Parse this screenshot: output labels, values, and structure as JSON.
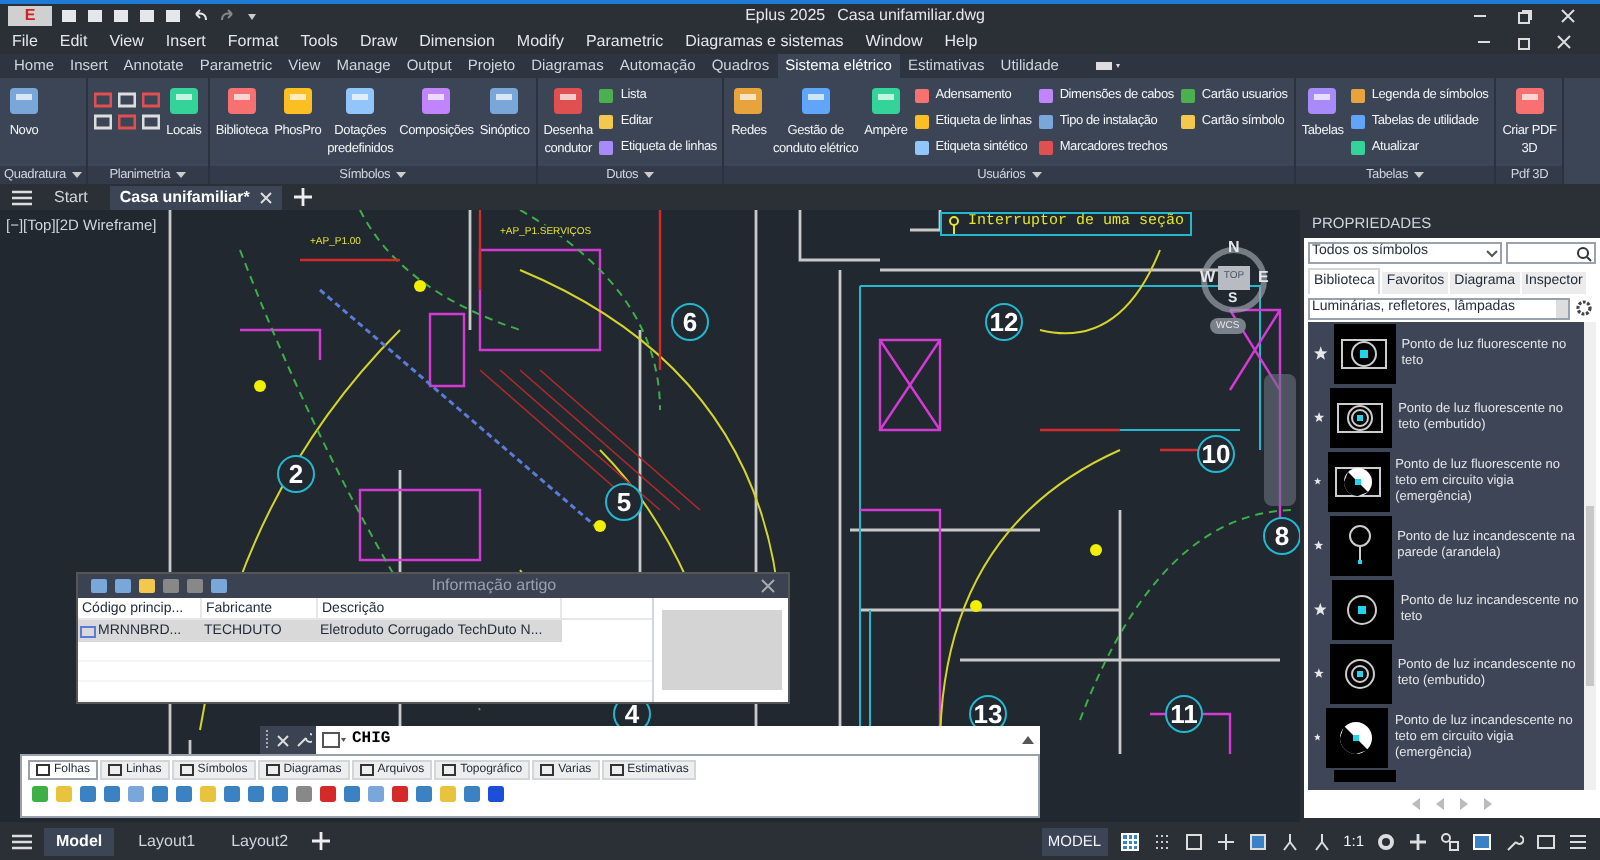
{
  "window": {
    "logo": "E",
    "title": "Eplus 2025",
    "document": "Casa unifamiliar.dwg"
  },
  "menu": [
    "File",
    "Edit",
    "View",
    "Insert",
    "Format",
    "Tools",
    "Draw",
    "Dimension",
    "Modify",
    "Parametric",
    "Diagramas e sistemas",
    "Window",
    "Help"
  ],
  "ribbon_tabs": [
    {
      "label": "Home",
      "selected": false
    },
    {
      "label": "Insert",
      "selected": false
    },
    {
      "label": "Annotate",
      "selected": false
    },
    {
      "label": "Parametric",
      "selected": false
    },
    {
      "label": "View",
      "selected": false
    },
    {
      "label": "Manage",
      "selected": false
    },
    {
      "label": "Output",
      "selected": false
    },
    {
      "label": "Projeto",
      "selected": false
    },
    {
      "label": "Diagramas",
      "selected": false
    },
    {
      "label": "Automação",
      "selected": false
    },
    {
      "label": "Quadros",
      "selected": false
    },
    {
      "label": "Sistema elétrico",
      "selected": true
    },
    {
      "label": "Estimativas",
      "selected": false
    },
    {
      "label": "Utilidade",
      "selected": false
    }
  ],
  "ribbon_panels": [
    {
      "label": "Quadratura",
      "items": [
        {
          "kind": "large",
          "label": "Novo"
        }
      ]
    },
    {
      "label": "Planimetria",
      "items": [
        {
          "kind": "icon"
        },
        {
          "kind": "icon"
        },
        {
          "kind": "icon"
        },
        {
          "kind": "icon"
        },
        {
          "kind": "icon"
        },
        {
          "kind": "icon"
        },
        {
          "kind": "large",
          "label": "Locais"
        }
      ]
    },
    {
      "label": "Símbolos",
      "items": [
        {
          "kind": "large",
          "label": "Biblioteca"
        },
        {
          "kind": "large",
          "label": "PhosPro"
        },
        {
          "kind": "large",
          "label": "Dotações\npredefinidos"
        },
        {
          "kind": "large",
          "label": "Composições"
        },
        {
          "kind": "large",
          "label": "Sinóptico"
        }
      ]
    },
    {
      "label": "Dutos",
      "items": [
        {
          "kind": "large",
          "label": "Desenha\ncondutor"
        },
        {
          "kind": "small",
          "label": "Lista"
        },
        {
          "kind": "small",
          "label": "Editar"
        },
        {
          "kind": "small",
          "label": "Etiqueta de linhas"
        }
      ]
    },
    {
      "label": "Usuários",
      "items": [
        {
          "kind": "large",
          "label": "Redes"
        },
        {
          "kind": "large",
          "label": "Gestão de\nconduto elétrico"
        },
        {
          "kind": "large",
          "label": "Ampère"
        },
        {
          "kind": "small",
          "label": "Adensamento"
        },
        {
          "kind": "small",
          "label": "Etiqueta de linhas"
        },
        {
          "kind": "small",
          "label": "Etiqueta sintético"
        },
        {
          "kind": "small",
          "label": "Dimensões de cabos"
        },
        {
          "kind": "small",
          "label": "Tipo de instalação"
        },
        {
          "kind": "small",
          "label": "Marcadores trechos"
        },
        {
          "kind": "small",
          "label": "Cartão usuarios"
        },
        {
          "kind": "small",
          "label": "Cartão símbolo"
        }
      ]
    },
    {
      "label": "Tabelas",
      "items": [
        {
          "kind": "large",
          "label": "Tabelas"
        },
        {
          "kind": "small",
          "label": "Legenda de símbolos"
        },
        {
          "kind": "small",
          "label": "Tabelas de utilidade"
        },
        {
          "kind": "small",
          "label": "Atualizar"
        }
      ]
    },
    {
      "label": "Pdf 3D",
      "items": [
        {
          "kind": "large",
          "label": "Criar PDF\n3D"
        }
      ]
    }
  ],
  "doc_tabs": [
    {
      "label": "Start",
      "selected": false
    },
    {
      "label": "Casa unifamiliar*",
      "selected": true
    }
  ],
  "viewport_label": "[−][Top][2D Wireframe]",
  "drawing": {
    "legend": "Interruptor de uma seção",
    "circuit_labels": [
      "+AP_P1.00",
      "+AP_P1.SERVIÇOS"
    ],
    "rooms": [
      "2",
      "6",
      "5",
      "12",
      "10",
      "8",
      "4",
      "13",
      "11"
    ]
  },
  "viewcube": {
    "north": "N",
    "south": "S",
    "east": "E",
    "west": "W",
    "top": "TOP",
    "ucs": "WCS"
  },
  "article_dialog": {
    "title": "Informação artigo",
    "columns": [
      "Código princip...",
      "Fabricante",
      "Descrição"
    ],
    "rows": [
      {
        "cells": [
          "MRNNBRD...",
          "TECHDUTO",
          "Eletroduto Corrugado TechDuto N..."
        ],
        "selected": true
      }
    ]
  },
  "command_line": {
    "value": "CHIG"
  },
  "toolbar_tabs": [
    {
      "label": "Folhas",
      "selected": true
    },
    {
      "label": "Linhas",
      "selected": false
    },
    {
      "label": "Símbolos",
      "selected": false
    },
    {
      "label": "Diagramas",
      "selected": false
    },
    {
      "label": "Arquivos",
      "selected": false
    },
    {
      "label": "Topográfico",
      "selected": false
    },
    {
      "label": "Varias",
      "selected": false
    },
    {
      "label": "Estimativas",
      "selected": false
    }
  ],
  "layout_tabs": [
    {
      "label": "Model",
      "selected": true
    },
    {
      "label": "Layout1",
      "selected": false
    },
    {
      "label": "Layout2",
      "selected": false
    }
  ],
  "status_bar": {
    "space": "MODEL",
    "scale": "1:1"
  },
  "properties": {
    "title": "PROPRIEDADES",
    "filter": "Todos os símbolos",
    "tabs": [
      {
        "label": "Biblioteca",
        "selected": true
      },
      {
        "label": "Favoritos",
        "selected": false
      },
      {
        "label": "Diagrama",
        "selected": false
      },
      {
        "label": "Inspector",
        "selected": false
      }
    ],
    "category": "Luminárias, refletores, lâmpadas",
    "symbols": [
      {
        "label": "Ponto de luz fluorescente no teto",
        "kind": "fluorescent"
      },
      {
        "label": "Ponto de luz fluorescente no teto (embutido)",
        "kind": "fluorescent-recessed"
      },
      {
        "label": "Ponto de luz fluorescente no teto em circuito vigia (emergência)",
        "kind": "fluorescent-emergency"
      },
      {
        "label": "Ponto de luz incandescente na parede (arandela)",
        "kind": "wall"
      },
      {
        "label": "Ponto de luz incandescente no teto",
        "kind": "ceiling"
      },
      {
        "label": "Ponto de luz incandescente no teto (embutido)",
        "kind": "ceiling-recessed"
      },
      {
        "label": "Ponto de luz incandescente no teto em circuito vigia (emergência)",
        "kind": "ceiling-emergency"
      }
    ]
  }
}
